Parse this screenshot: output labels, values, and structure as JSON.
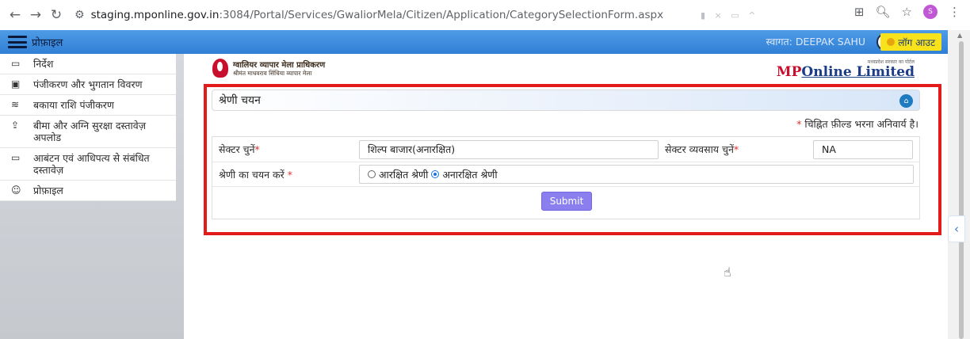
{
  "browser": {
    "url_host": "staging.mponline.gov.in",
    "url_path": ":3084/Portal/Services/GwaliorMela/Citizen/Application/CategorySelectionForm.aspx",
    "profile_initial": "S"
  },
  "header": {
    "brand": "प्रोफ़ाइल",
    "welcome": "स्वागत: DEEPAK SAHU",
    "logout": "लॉग आउट"
  },
  "sidebar": {
    "items": [
      {
        "icon": "document-icon",
        "label": "निर्देश"
      },
      {
        "icon": "register-icon",
        "label": "पंजीकरण और भुगतान विवरण"
      },
      {
        "icon": "money-icon",
        "label": "बकाया राशि पंजीकरण"
      },
      {
        "icon": "upload-icon",
        "label": "बीमा और अग्नि सुरक्षा दस्तावेज़ अपलोड"
      },
      {
        "icon": "document-icon",
        "label": "आबंटन एवं आधिपत्य से संबंधित दस्तावेज़"
      },
      {
        "icon": "profile-icon",
        "label": "प्रोफ़ाइल"
      }
    ]
  },
  "logos": {
    "left_line1": "ग्वालियर व्यापार मेला प्राधिकरण",
    "left_line2": "श्रीमंत माधवराव सिंधिया व्यापार मेला",
    "right_tag": "मध्यप्रदेश सरकार का पोर्टल",
    "right_main_mp": "MP",
    "right_main_online": "Online Limited"
  },
  "panel": {
    "title": "श्रेणी चयन",
    "required_note": "चिह्नित फ़ील्ड भरना अनिवार्य है।"
  },
  "form": {
    "sector_label": "सेक्टर चुनें",
    "sector_value": "शिल्प बाजार(अनारक्षित)",
    "business_label": "सेक्टर व्यवसाय चुनें",
    "business_value": "NA",
    "category_label": "श्रेणी का चयन करें",
    "option_reserved": "आरक्षित श्रेणी",
    "option_unreserved": "अनारक्षित श्रेणी",
    "selected_option": "अनारक्षित श्रेणी",
    "submit": "Submit"
  },
  "colors": {
    "header_blue": "#2f7fd5",
    "highlight_red": "#e31b1b",
    "submit_purple": "#8b7ff0",
    "logout_yellow": "#f7e21b"
  }
}
